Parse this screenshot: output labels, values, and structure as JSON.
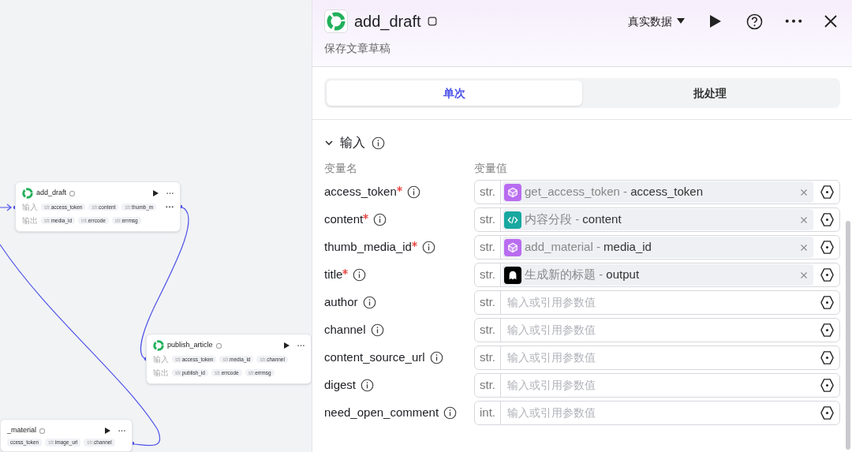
{
  "canvas": {
    "nodes": [
      {
        "title": "add_draft",
        "logo": true,
        "inputs_label": "输入",
        "inputs": [
          {
            "type": "str.",
            "name": "access_token"
          },
          {
            "type": "str.",
            "name": "content"
          },
          {
            "type": "str.",
            "name": "thumb_m"
          }
        ],
        "outputs_label": "输出",
        "outputs": [
          {
            "type": "str.",
            "name": "media_id"
          },
          {
            "type": "int.",
            "name": "errcode"
          },
          {
            "type": "str.",
            "name": "errmsg"
          }
        ],
        "overflow": true
      },
      {
        "title": "publish_article",
        "logo": true,
        "inputs_label": "输入",
        "inputs": [
          {
            "type": "str.",
            "name": "access_token"
          },
          {
            "type": "str.",
            "name": "media_id"
          },
          {
            "type": "str.",
            "name": "channel"
          }
        ],
        "outputs_label": "输出",
        "outputs": [
          {
            "type": "str.",
            "name": "publish_id"
          },
          {
            "type": "str.",
            "name": "errcode"
          },
          {
            "type": "str.",
            "name": "errmsg"
          }
        ],
        "overflow": false
      },
      {
        "title": "_material",
        "logo": false,
        "inputs": [
          {
            "name": "ccess_token"
          },
          {
            "type": "str.",
            "name": "image_url"
          },
          {
            "type": "str.",
            "name": "channel"
          }
        ],
        "overflow": false
      }
    ]
  },
  "panel": {
    "title": "add_draft",
    "subtitle": "保存文章草稿",
    "data_mode": "真实数据",
    "tabs": [
      {
        "label": "单次",
        "selected": true
      },
      {
        "label": "批处理",
        "selected": false
      }
    ],
    "section": {
      "title": "输入",
      "expanded": true,
      "col_name": "变量名",
      "col_value": "变量值",
      "rows": [
        {
          "name": "access_token",
          "required": true,
          "type": "str.",
          "ref": {
            "kind": "plugin",
            "source": "get_access_token",
            "separator": "-",
            "field": "access_token"
          }
        },
        {
          "name": "content",
          "required": true,
          "type": "str.",
          "ref": {
            "kind": "code",
            "source": "内容分段",
            "separator": "-",
            "field": "content"
          }
        },
        {
          "name": "thumb_media_id",
          "required": true,
          "type": "str.",
          "ref": {
            "kind": "plugin",
            "source": "add_material",
            "separator": "-",
            "field": "media_id"
          }
        },
        {
          "name": "title",
          "required": true,
          "type": "str.",
          "ref": {
            "kind": "llm",
            "source": "生成新的标题",
            "separator": "-",
            "field": "output"
          }
        },
        {
          "name": "author",
          "required": false,
          "type": "str.",
          "placeholder": "输入或引用参数值"
        },
        {
          "name": "channel",
          "required": false,
          "type": "str.",
          "placeholder": "输入或引用参数值"
        },
        {
          "name": "content_source_url",
          "required": false,
          "type": "str.",
          "placeholder": "输入或引用参数值"
        },
        {
          "name": "digest",
          "required": false,
          "type": "str.",
          "placeholder": "输入或引用参数值"
        },
        {
          "name": "need_open_comment",
          "required": false,
          "type": "int.",
          "placeholder": "输入或引用参数值"
        }
      ]
    }
  }
}
